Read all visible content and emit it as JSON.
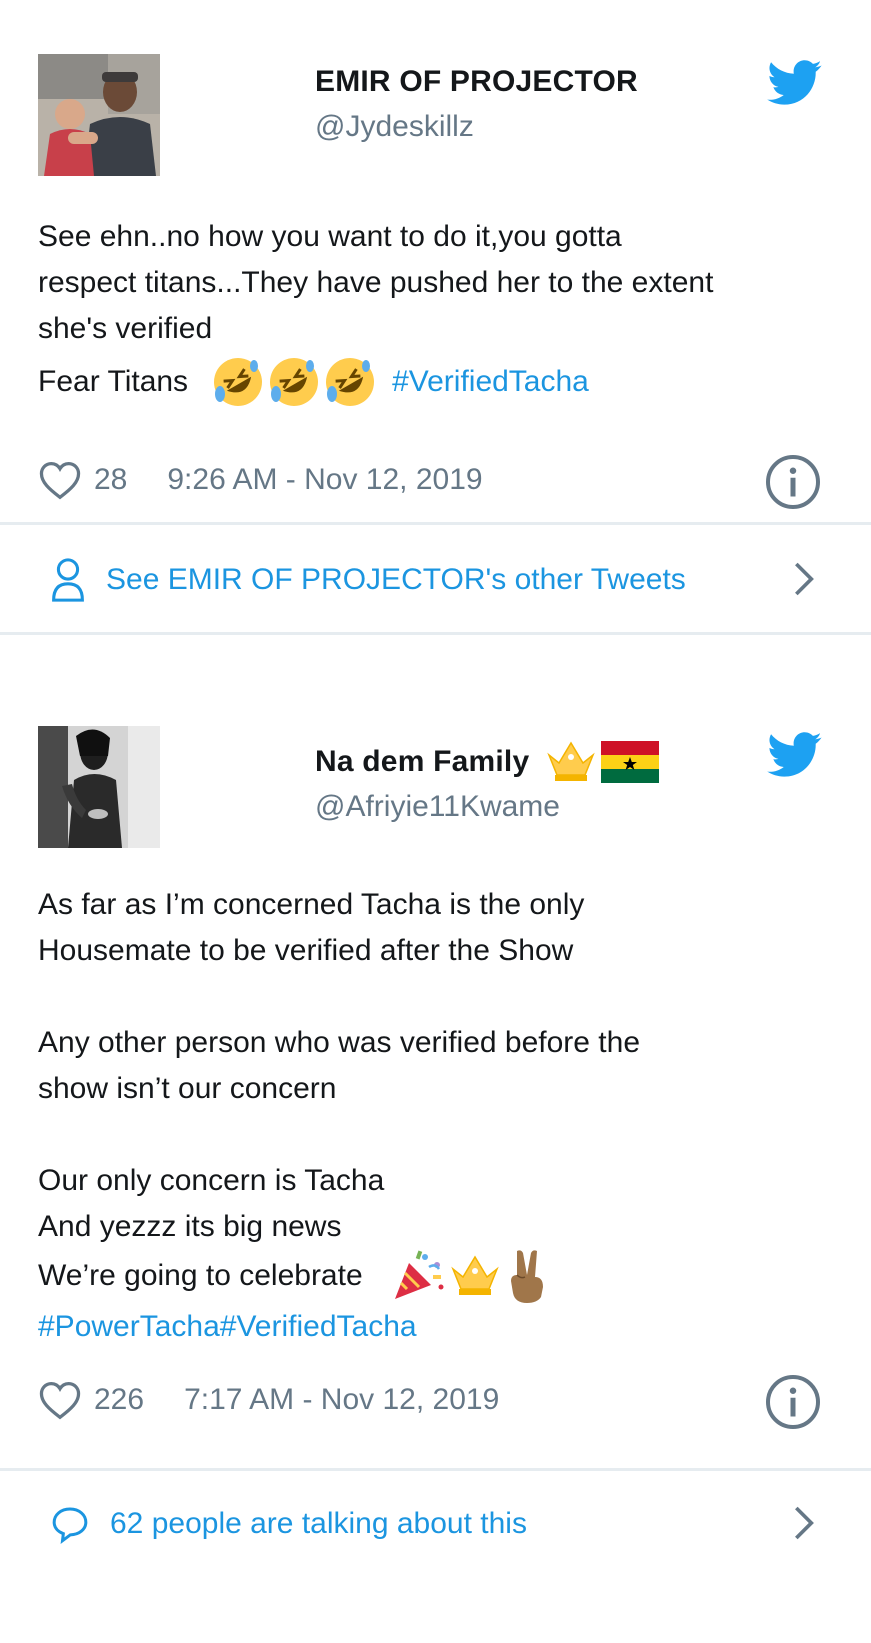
{
  "tweets": [
    {
      "author_name": "EMIR OF PROJECTOR",
      "handle": "@Jydeskillz",
      "text_lines": [
        "See ehn..no how you want to do it,you gotta",
        "respect titans...They have pushed her to the extent",
        "she's verified"
      ],
      "last_line_text": "Fear Titans",
      "last_line_hashtag": "#VerifiedTacha",
      "likes": "28",
      "time": "9:26 AM - Nov 12, 2019",
      "footer": "See EMIR OF PROJECTOR's  other Tweets"
    },
    {
      "author_name": "Na dem Family",
      "handle": "@Afriyie11Kwame",
      "para1": [
        "As far as I’m concerned Tacha is the only",
        "Housemate to be verified after the Show"
      ],
      "para2": [
        "Any other person who was verified before the",
        "show isn’t our concern"
      ],
      "para3": [
        "Our only concern is Tacha",
        "And yezzz its big news"
      ],
      "celebrate_text": "We’re going to celebrate",
      "hashtags": "#PowerTacha#VerifiedTacha",
      "likes": "226",
      "time": "7:17 AM - Nov 12, 2019",
      "footer": "62 people are talking about this"
    }
  ],
  "colors": {
    "link": "#1b95e0",
    "secondary": "#657786",
    "divider": "#e6ecf0",
    "twitter_blue": "#1da1f2"
  },
  "icons": [
    "twitter-bird-icon",
    "heart-icon",
    "info-icon",
    "person-icon",
    "chevron-right-icon",
    "speech-bubble-icon",
    "rofl-emoji",
    "crown-emoji",
    "ghana-flag-emoji",
    "party-popper-emoji",
    "victory-hand-emoji"
  ]
}
